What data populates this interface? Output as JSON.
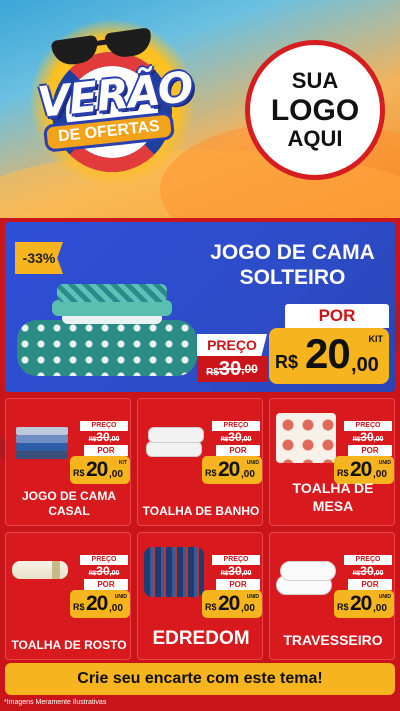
{
  "header": {
    "headline": "VERÃO",
    "subheadline": "DE OFERTAS",
    "logo_lines": [
      "SUA",
      "LOGO",
      "AQUI"
    ]
  },
  "hero": {
    "discount": "-33%",
    "title": "JOGO DE CAMA SOLTEIRO",
    "preco_label": "PREÇO",
    "old_currency": "R$",
    "old_integer": "30",
    "old_cents": ",00",
    "por_label": "POR",
    "new_currency": "R$",
    "new_integer": "20",
    "new_cents": "00",
    "unit": "KIT"
  },
  "products": [
    {
      "name": "JOGO DE CAMA CASAL",
      "preco_label": "PREÇO",
      "old_currency": "R$",
      "old_integer": "30",
      "old_cents": ",00",
      "por_label": "POR",
      "new_currency": "R$",
      "new_integer": "20",
      "new_cents": "00",
      "unit": "KIT"
    },
    {
      "name": "TOALHA DE BANHO",
      "preco_label": "PREÇO",
      "old_currency": "R$",
      "old_integer": "30",
      "old_cents": ",00",
      "por_label": "POR",
      "new_currency": "R$",
      "new_integer": "20",
      "new_cents": "00",
      "unit": "UNID"
    },
    {
      "name": "TOALHA DE MESA",
      "preco_label": "PREÇO",
      "old_currency": "R$",
      "old_integer": "30",
      "old_cents": ",00",
      "por_label": "POR",
      "new_currency": "R$",
      "new_integer": "20",
      "new_cents": "00",
      "unit": "UNID"
    },
    {
      "name": "TOALHA DE ROSTO",
      "preco_label": "PREÇO",
      "old_currency": "R$",
      "old_integer": "30",
      "old_cents": ",00",
      "por_label": "POR",
      "new_currency": "R$",
      "new_integer": "20",
      "new_cents": "00",
      "unit": "UNID"
    },
    {
      "name": "EDREDOM",
      "preco_label": "PREÇO",
      "old_currency": "R$",
      "old_integer": "30",
      "old_cents": ",00",
      "por_label": "POR",
      "new_currency": "R$",
      "new_integer": "20",
      "new_cents": "00",
      "unit": "UNID"
    },
    {
      "name": "TRAVESSEIRO",
      "preco_label": "PREÇO",
      "old_currency": "R$",
      "old_integer": "30",
      "old_cents": ",00",
      "por_label": "POR",
      "new_currency": "R$",
      "new_integer": "20",
      "new_cents": "00",
      "unit": "UNID"
    }
  ],
  "cta": "Crie seu encarte com este tema!",
  "disclaimer": "*Imagens Meramente Ilustrativas",
  "colors": {
    "background_red": "#c9141a",
    "card_red": "#d81a1f",
    "hero_blue": "#2e4fd9",
    "accent_yellow": "#f6b41f",
    "text_dark": "#111111"
  }
}
